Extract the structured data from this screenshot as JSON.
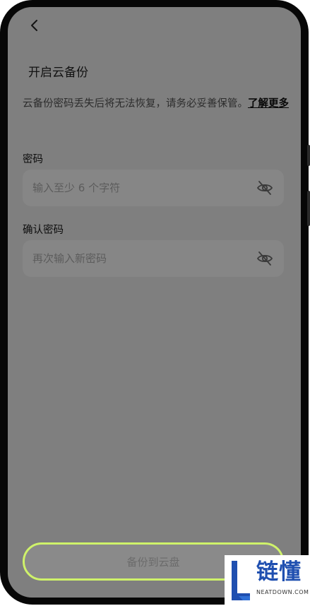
{
  "header": {
    "back_icon": "chevron-left-icon",
    "title": "开启云备份"
  },
  "notice": {
    "text": "云备份密码丢失后将无法恢复，请务必妥善保管。",
    "link": "了解更多"
  },
  "password": {
    "label": "密码",
    "placeholder": "输入至少 6 个字符",
    "toggle_icon": "eye-off-icon"
  },
  "confirm_password": {
    "label": "确认密码",
    "placeholder": "再次输入新密码",
    "toggle_icon": "eye-off-icon"
  },
  "submit": {
    "label": "备份到云盘"
  },
  "watermark": {
    "brand": "链懂",
    "domain": "NEATDOWN.COM"
  },
  "colors": {
    "overlay": "#7f7f7f",
    "button_border": "#cff26a",
    "watermark_blue": "#1f4fb0"
  }
}
